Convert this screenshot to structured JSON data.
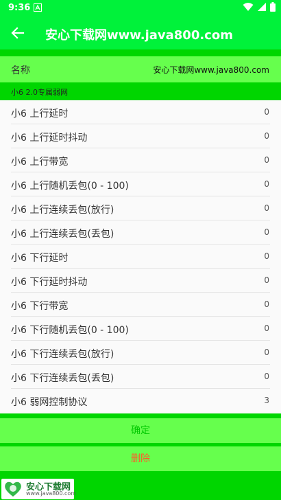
{
  "status_bar": {
    "time": "9:36",
    "icons": [
      "notification-a-icon",
      "wifi-icon",
      "signal-icon",
      "battery-icon"
    ]
  },
  "app_bar": {
    "title": "安心下载网www.java800.com",
    "back_icon": "arrow-left-icon"
  },
  "name_row": {
    "label": "名称",
    "value": "安心下载网www.java800.com"
  },
  "section_header": "小6 2.0专属弱网",
  "items": [
    {
      "label": "小6  上行延时",
      "value": "0"
    },
    {
      "label": "小6  上行延时抖动",
      "value": "0"
    },
    {
      "label": "小6  上行带宽",
      "value": "0"
    },
    {
      "label": "小6  上行随机丢包(0 - 100)",
      "value": "0"
    },
    {
      "label": "小6  上行连续丢包(放行)",
      "value": "0"
    },
    {
      "label": "小6  上行连续丢包(丢包)",
      "value": "0"
    },
    {
      "label": "小6  下行延时",
      "value": "0"
    },
    {
      "label": "小6  下行延时抖动",
      "value": "0"
    },
    {
      "label": "小6  下行带宽",
      "value": "0"
    },
    {
      "label": "小6  下行随机丢包(0 - 100)",
      "value": "0"
    },
    {
      "label": "小6  下行连续丢包(放行)",
      "value": "0"
    },
    {
      "label": "小6  下行连续丢包(丢包)",
      "value": "0"
    },
    {
      "label": "小6  弱网控制协议",
      "value": "3"
    }
  ],
  "buttons": {
    "confirm": "确定",
    "delete": "删除"
  },
  "watermark": {
    "brand": "安心下载网",
    "url": "www.java800.com"
  },
  "colors": {
    "bar_green": "#00f23a",
    "light_green": "#66ff4d",
    "dark_green": "#00d600",
    "delete_red": "#ff5b2b"
  }
}
